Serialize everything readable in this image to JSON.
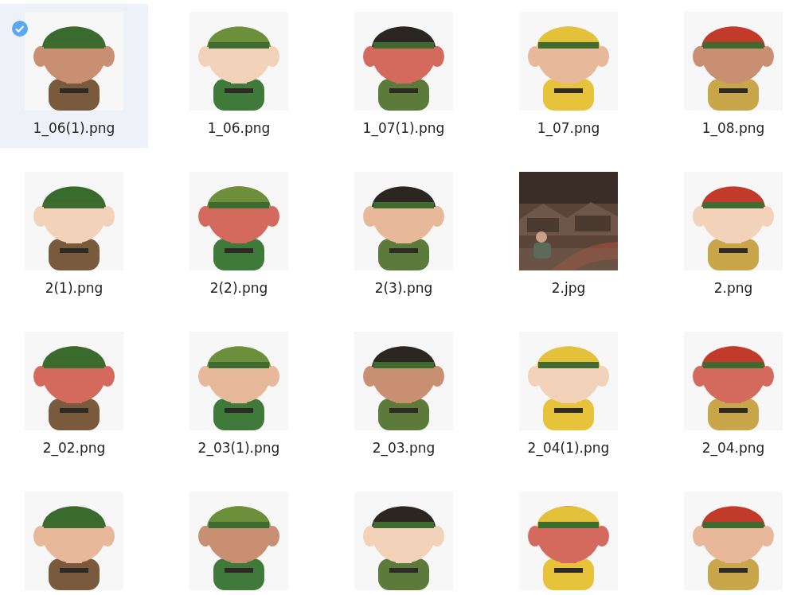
{
  "items": [
    {
      "label": "1_06(1).png",
      "selected": true
    },
    {
      "label": "1_06.png",
      "selected": false
    },
    {
      "label": "1_07(1).png",
      "selected": false
    },
    {
      "label": "1_07.png",
      "selected": false
    },
    {
      "label": "1_08.png",
      "selected": false
    },
    {
      "label": "2(1).png",
      "selected": false
    },
    {
      "label": "2(2).png",
      "selected": false
    },
    {
      "label": "2(3).png",
      "selected": false
    },
    {
      "label": "2.jpg",
      "selected": false
    },
    {
      "label": "2.png",
      "selected": false
    },
    {
      "label": "2_02.png",
      "selected": false
    },
    {
      "label": "2_03(1).png",
      "selected": false
    },
    {
      "label": "2_03.png",
      "selected": false
    },
    {
      "label": "2_04(1).png",
      "selected": false
    },
    {
      "label": "2_04.png",
      "selected": false
    },
    {
      "selected": false
    },
    {
      "selected": false
    },
    {
      "selected": false
    },
    {
      "selected": false
    },
    {
      "selected": false
    }
  ]
}
